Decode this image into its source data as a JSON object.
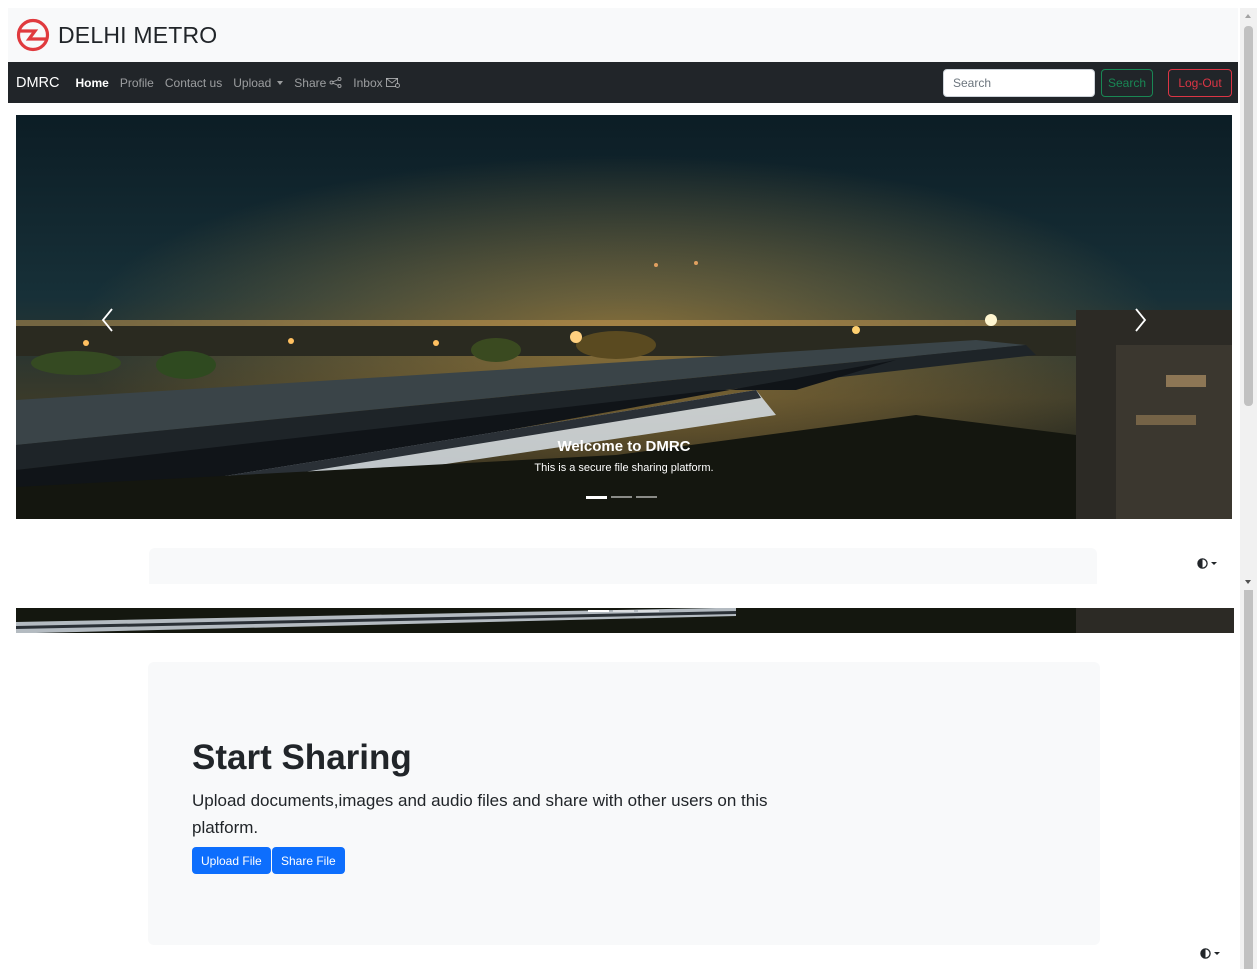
{
  "brand": {
    "title": "DELHI METRO",
    "logo_icon": "dmrc-logo-icon",
    "color": "#e03a3e"
  },
  "navbar": {
    "brand": "DMRC",
    "links": [
      {
        "label": "Home",
        "active": true
      },
      {
        "label": "Profile"
      },
      {
        "label": "Contact us"
      },
      {
        "label": "Upload",
        "dropdown": true
      },
      {
        "label": "Share",
        "icon": "share-icon"
      },
      {
        "label": "Inbox",
        "icon": "inbox-icon"
      }
    ],
    "search_placeholder": "Search",
    "search_button": "Search",
    "logout_button": "Log-Out"
  },
  "carousel": {
    "caption_title": "Welcome to DMRC",
    "caption_text": "This is a secure file sharing platform.",
    "slide_count": 3,
    "active_slide": 1
  },
  "jumbotron": {
    "heading": "Start Sharing",
    "text": "Upload documents,images and audio files and share with other users on this platform.",
    "upload_button": "Upload File",
    "share_button": "Share File"
  },
  "colors": {
    "navbar_bg": "#212529",
    "primary": "#0d6efd",
    "success": "#198754",
    "danger": "#dc3545",
    "light_bg": "#f8f9fa"
  }
}
